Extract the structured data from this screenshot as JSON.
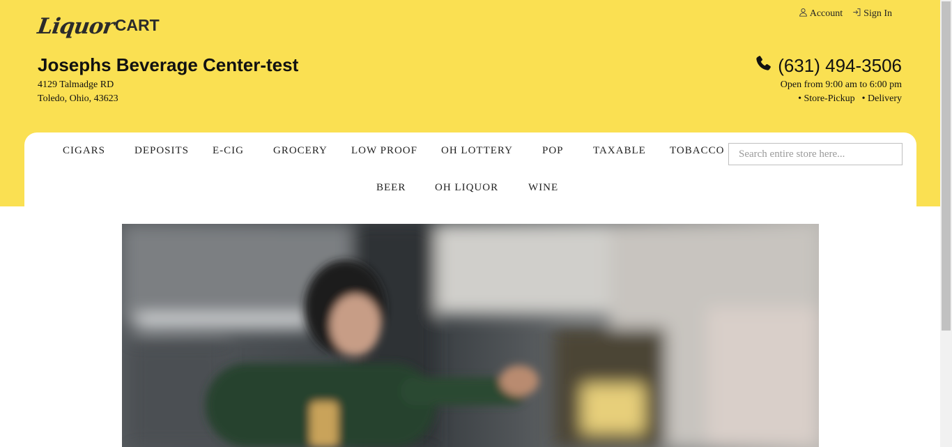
{
  "logo": {
    "script": "Liquor",
    "suffix": "CART"
  },
  "top_links": {
    "account": "Account",
    "sign_in": "Sign In"
  },
  "store": {
    "name": "Josephs Beverage Center-test",
    "address_line1": "4129 Talmadge RD",
    "address_line2": "Toledo, Ohio, 43623",
    "phone": "(631) 494-3506",
    "hours": "Open from 9:00 am to 6:00 pm",
    "service_pickup": "• Store-Pickup",
    "service_delivery": "• Delivery"
  },
  "nav": {
    "row1": [
      "CIGARS",
      "DEPOSITS",
      "E-CIG",
      "GROCERY",
      "LOW PROOF",
      "OH LOTTERY",
      "POP",
      "TAXABLE",
      "TOBACCO"
    ],
    "row2": [
      "BEER",
      "OH LIQUOR",
      "WINE"
    ]
  },
  "search": {
    "placeholder": "Search entire store here..."
  },
  "colors": {
    "header_bg": "#fae052",
    "text": "#111111"
  },
  "icons": [
    "user-icon",
    "sign-in-icon",
    "phone-icon"
  ]
}
